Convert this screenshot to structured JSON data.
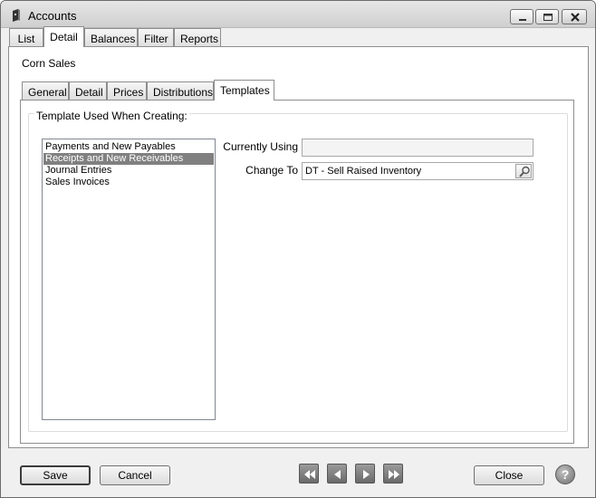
{
  "window": {
    "title": "Accounts"
  },
  "top_tabs": [
    {
      "label": "List"
    },
    {
      "label": "Detail"
    },
    {
      "label": "Balances"
    },
    {
      "label": "Filter"
    },
    {
      "label": "Reports"
    }
  ],
  "account": {
    "name": "Corn Sales"
  },
  "sub_tabs": [
    {
      "label": "General"
    },
    {
      "label": "Detail"
    },
    {
      "label": "Prices"
    },
    {
      "label": "Distributions"
    },
    {
      "label": "Templates"
    }
  ],
  "templates": {
    "group_label": "Template Used When Creating:",
    "items": [
      "Payments and New Payables",
      "Receipts and New Receivables",
      "Journal Entries",
      "Sales Invoices"
    ],
    "selected_index": 1,
    "currently_using_label": "Currently Using",
    "currently_using_value": "",
    "change_to_label": "Change To",
    "change_to_value": "DT - Sell Raised Inventory"
  },
  "footer": {
    "save_label": "Save",
    "cancel_label": "Cancel",
    "close_label": "Close",
    "help_glyph": "?"
  }
}
